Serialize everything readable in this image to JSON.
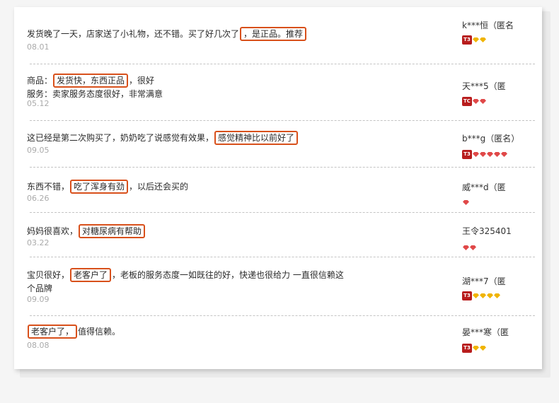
{
  "colors": {
    "highlight_border": "#d8501b",
    "badge_red": "#b81d1d",
    "gem_red": "#e04848",
    "gem_gold": "#f0b400"
  },
  "reviews": [
    {
      "lines": [
        [
          "发货晚了一天，店家送了小礼物，还不错。买了好几次了",
          "，是正品。推荐",
          ""
        ]
      ],
      "date": "08.01",
      "user": "k***恒（匿名",
      "badge": "T3",
      "gems": "gold",
      "gem_count": 2
    },
    {
      "lines": [
        [
          "商品：",
          "发货快，东西正品",
          "，很好"
        ],
        [
          "服务：卖家服务态度很好，非常满意",
          "",
          ""
        ]
      ],
      "date": "05.12",
      "user": "天***5（匿",
      "badge": "TC",
      "gems": "red",
      "gem_count": 2
    },
    {
      "lines": [
        [
          "这已经是第二次购买了，奶奶吃了说感觉有效果，",
          "感觉精神比以前好了",
          ""
        ]
      ],
      "date": "09.05",
      "user": "b***g（匿名）",
      "badge": "T3",
      "gems": "red",
      "gem_count": 5
    },
    {
      "lines": [
        [
          "东西不错，",
          "吃了浑身有劲",
          "，以后还会买的"
        ]
      ],
      "date": "06.26",
      "user": "威***d（匿",
      "badge": "",
      "gems": "red",
      "gem_count": 1
    },
    {
      "lines": [
        [
          "妈妈很喜欢，",
          "对糖尿病有帮助",
          ""
        ]
      ],
      "date": "03.22",
      "user": "王令325401",
      "badge": "",
      "gems": "red",
      "gem_count": 2
    },
    {
      "lines": [
        [
          "宝贝很好，",
          "老客户了",
          "，老板的服务态度一如既往的好，快递也很给力 一直很信赖这"
        ],
        [
          "个品牌",
          "",
          ""
        ]
      ],
      "date": "09.09",
      "user": "湖***7（匿",
      "badge": "T3",
      "gems": "gold",
      "gem_count": 4
    },
    {
      "lines": [
        [
          "",
          "老客户了，",
          "值得信赖。"
        ]
      ],
      "date": "08.08",
      "user": "晏***寒（匿",
      "badge": "T3",
      "gems": "gold",
      "gem_count": 2
    }
  ]
}
